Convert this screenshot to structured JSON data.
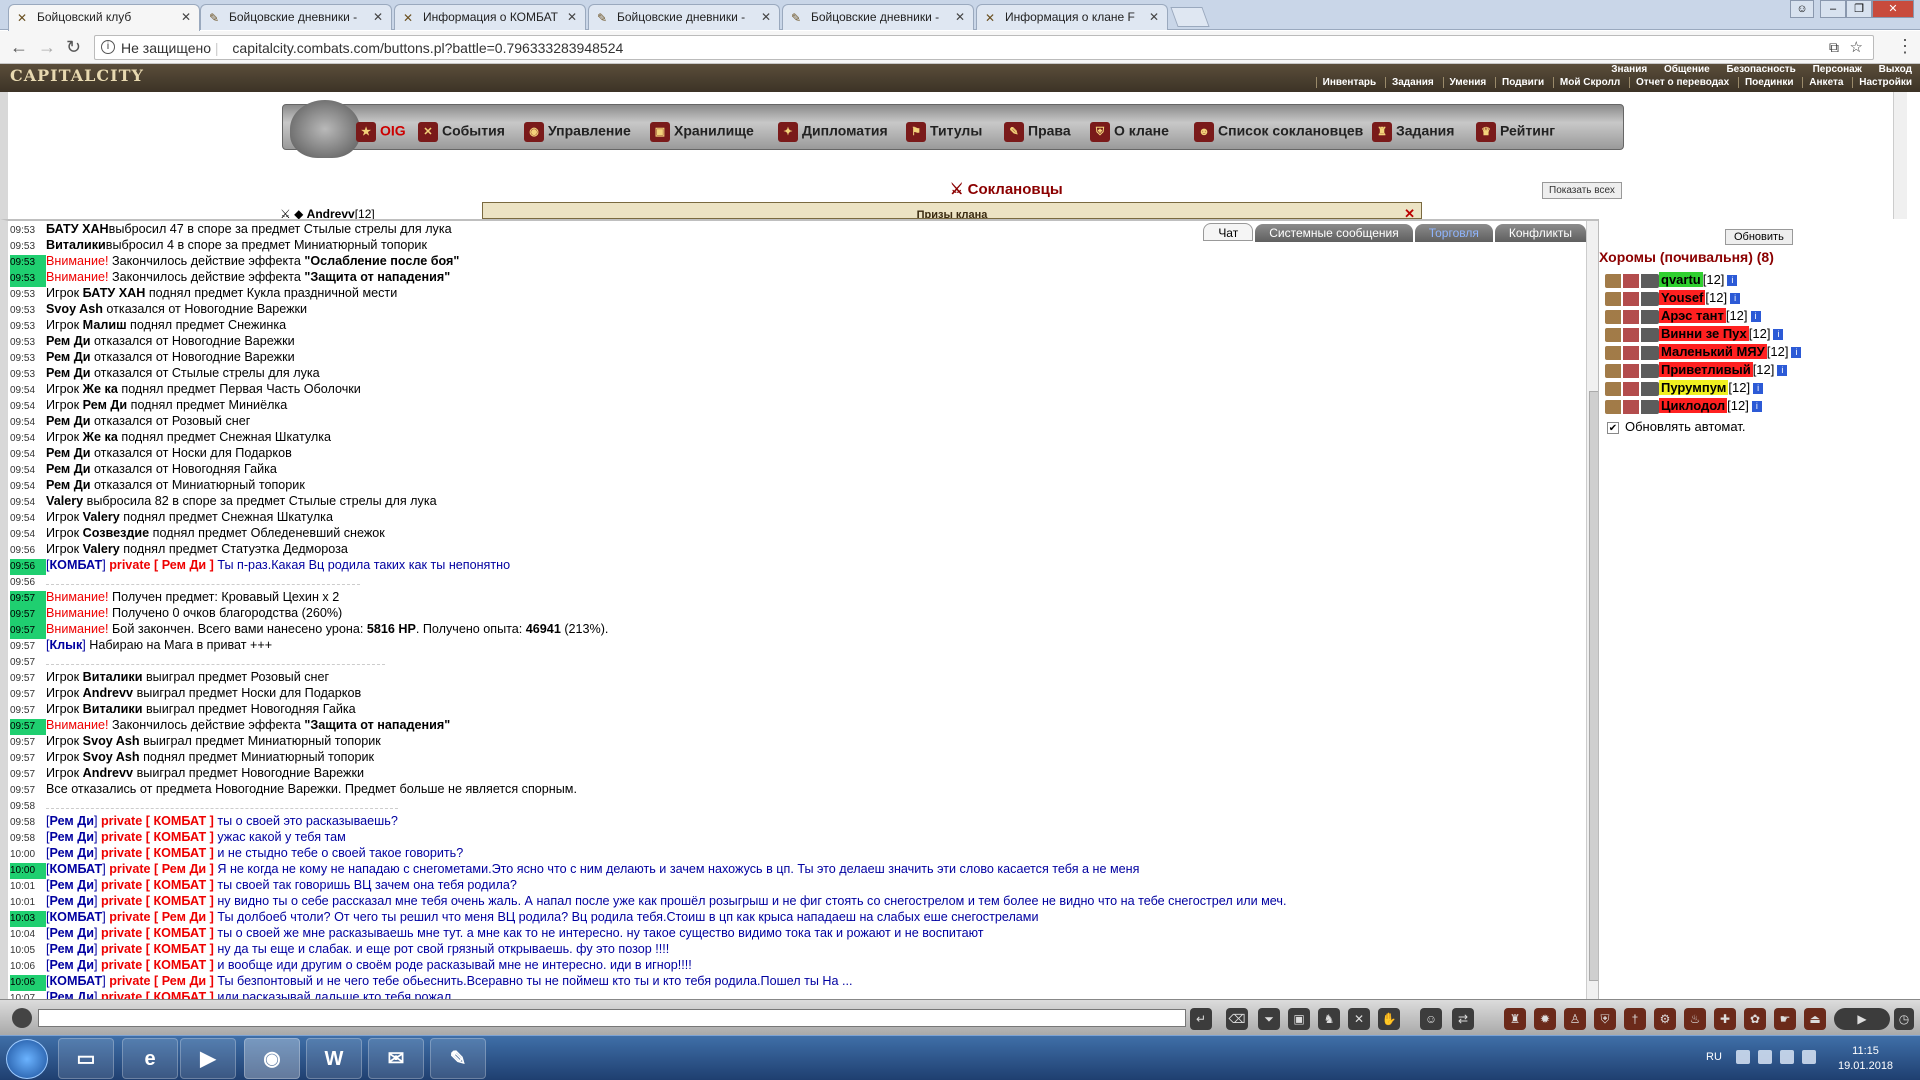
{
  "browser": {
    "tabs": [
      {
        "label": "Бойцовский клуб",
        "active": true
      },
      {
        "label": "Бойцовские дневники -",
        "active": false
      },
      {
        "label": "Информация о КОМБАТ",
        "active": false
      },
      {
        "label": "Бойцовские дневники -",
        "active": false
      },
      {
        "label": "Бойцовские дневники -",
        "active": false
      },
      {
        "label": "Информация о клане F",
        "active": false
      }
    ],
    "security_label": "Не защищено",
    "url": "capitalcity.combats.com/buttons.pl?battle=0.796333283948524"
  },
  "game_header": {
    "logo": "CAPITALCITY",
    "top_links": [
      "Знания",
      "Общение",
      "Безопасность",
      "Персонаж",
      "Выход"
    ],
    "sub_links": [
      "Инвентарь",
      "Задания",
      "Умения",
      "Подвиги",
      "Мой Скролл",
      "Отчет о переводах",
      "Поединки",
      "Анкета",
      "Настройки"
    ]
  },
  "clan_menu": {
    "items": [
      "OIG",
      "События",
      "Управление",
      "Хранилище",
      "Дипломатия",
      "Титулы",
      "Права",
      "О клане",
      "Список соклановцев",
      "Задания",
      "Рейтинг"
    ],
    "section_title": "Соклановцы",
    "show_all": "Показать всех",
    "partial_member": "Andrevv",
    "partial_level": "[12]",
    "prize_bar": "Призы клана"
  },
  "chat_tabs": [
    {
      "label": "Чат",
      "active": true
    },
    {
      "label": "Системные сообщения",
      "active": false
    },
    {
      "label": "Торговля",
      "active": false
    },
    {
      "label": "Конфликты",
      "active": false
    }
  ],
  "chat_lines": [
    {
      "time": "09:53",
      "g": false,
      "parts": [
        [
          "b",
          "БАТУ ХАН"
        ],
        [
          "",
          "выбросил 47 в споре за предмет Стылые стрелы для лука"
        ]
      ]
    },
    {
      "time": "09:53",
      "g": false,
      "parts": [
        [
          "b",
          "Виталики"
        ],
        [
          "",
          "выбросил 4 в споре за предмет Миниатюрный топорик"
        ]
      ]
    },
    {
      "time": "09:53",
      "g": true,
      "parts": [
        [
          "red",
          "Внимание!"
        ],
        [
          "",
          " Закончилось действие эффекта "
        ],
        [
          "b",
          "\"Ослабление после боя\""
        ]
      ]
    },
    {
      "time": "09:53",
      "g": true,
      "parts": [
        [
          "red",
          "Внимание!"
        ],
        [
          "",
          " Закончилось действие эффекта "
        ],
        [
          "b",
          "\"Защита от нападения\""
        ]
      ]
    },
    {
      "time": "09:53",
      "g": false,
      "parts": [
        [
          "",
          "Игрок "
        ],
        [
          "b",
          "БАТУ ХАН"
        ],
        [
          "",
          " поднял предмет Кукла праздничной мести"
        ]
      ]
    },
    {
      "time": "09:53",
      "g": false,
      "parts": [
        [
          "b",
          "Svoy Ash"
        ],
        [
          "",
          " отказался от Новогодние Варежки"
        ]
      ]
    },
    {
      "time": "09:53",
      "g": false,
      "parts": [
        [
          "",
          "Игрок "
        ],
        [
          "b",
          "Малиш"
        ],
        [
          "",
          " поднял предмет Снежинка"
        ]
      ]
    },
    {
      "time": "09:53",
      "g": false,
      "parts": [
        [
          "b",
          "Рем Ди"
        ],
        [
          "",
          " отказался от Новогодние Варежки"
        ]
      ]
    },
    {
      "time": "09:53",
      "g": false,
      "parts": [
        [
          "b",
          "Рем Ди"
        ],
        [
          "",
          " отказался от Новогодние Варежки"
        ]
      ]
    },
    {
      "time": "09:53",
      "g": false,
      "parts": [
        [
          "b",
          "Рем Ди"
        ],
        [
          "",
          " отказался от Стылые стрелы для лука"
        ]
      ]
    },
    {
      "time": "09:54",
      "g": false,
      "parts": [
        [
          "",
          "Игрок "
        ],
        [
          "b",
          "Же ка"
        ],
        [
          "",
          " поднял предмет Первая Часть Оболочки"
        ]
      ]
    },
    {
      "time": "09:54",
      "g": false,
      "parts": [
        [
          "",
          "Игрок "
        ],
        [
          "b",
          "Рем Ди"
        ],
        [
          "",
          " поднял предмет Миниёлка"
        ]
      ]
    },
    {
      "time": "09:54",
      "g": false,
      "parts": [
        [
          "b",
          "Рем Ди"
        ],
        [
          "",
          " отказался от Розовый снег"
        ]
      ]
    },
    {
      "time": "09:54",
      "g": false,
      "parts": [
        [
          "",
          "Игрок "
        ],
        [
          "b",
          "Же ка"
        ],
        [
          "",
          " поднял предмет Снежная Шкатулка"
        ]
      ]
    },
    {
      "time": "09:54",
      "g": false,
      "parts": [
        [
          "b",
          "Рем Ди"
        ],
        [
          "",
          " отказался от Носки для Подарков"
        ]
      ]
    },
    {
      "time": "09:54",
      "g": false,
      "parts": [
        [
          "b",
          "Рем Ди"
        ],
        [
          "",
          " отказался от Новогодняя Гайка"
        ]
      ]
    },
    {
      "time": "09:54",
      "g": false,
      "parts": [
        [
          "b",
          "Рем Ди"
        ],
        [
          "",
          " отказался от Миниатюрный топорик"
        ]
      ]
    },
    {
      "time": "09:54",
      "g": false,
      "parts": [
        [
          "b",
          "Valery"
        ],
        [
          "",
          " выбросила 82 в споре за предмет Стылые стрелы для лука"
        ]
      ]
    },
    {
      "time": "09:54",
      "g": false,
      "parts": [
        [
          "",
          "Игрок "
        ],
        [
          "b",
          "Valery"
        ],
        [
          "",
          " поднял предмет Снежная Шкатулка"
        ]
      ]
    },
    {
      "time": "09:54",
      "g": false,
      "parts": [
        [
          "",
          "Игрок "
        ],
        [
          "b",
          "Созвездие"
        ],
        [
          "",
          " поднял предмет Обледеневший снежок"
        ]
      ]
    },
    {
      "time": "09:56",
      "g": false,
      "parts": [
        [
          "",
          "Игрок "
        ],
        [
          "b",
          "Valery"
        ],
        [
          "",
          " поднял предмет Статуэтка Дедмороза"
        ]
      ]
    },
    {
      "time": "09:56",
      "g": true,
      "parts": [
        [
          "blue",
          "["
        ],
        [
          "nm",
          "КОМБАТ"
        ],
        [
          "blue",
          "] "
        ],
        [
          "pr",
          "private [ Рем Ди ]"
        ],
        [
          "blue",
          " Ты п-раз.Какая Вц родила таких как ты непонятно"
        ]
      ]
    },
    {
      "time": "09:56",
      "g": false,
      "parts": [
        [
          "smudge",
          ""
        ]
      ]
    },
    {
      "time": "09:57",
      "g": true,
      "parts": [
        [
          "red",
          "Внимание!"
        ],
        [
          "",
          " Получен предмет: Кровавый Цехин x 2"
        ]
      ]
    },
    {
      "time": "09:57",
      "g": true,
      "parts": [
        [
          "red",
          "Внимание!"
        ],
        [
          "",
          " Получено 0 очков благородства (260%)"
        ]
      ]
    },
    {
      "time": "09:57",
      "g": true,
      "parts": [
        [
          "red",
          "Внимание!"
        ],
        [
          "",
          " Бой закончен. Всего вами нанесено урона: "
        ],
        [
          "b",
          "5816 HP"
        ],
        [
          "",
          ". Получено опыта: "
        ],
        [
          "b",
          "46941"
        ],
        [
          "",
          " (213%)."
        ]
      ]
    },
    {
      "time": "09:57",
      "g": false,
      "parts": [
        [
          "blue",
          "["
        ],
        [
          "nm",
          "Клык"
        ],
        [
          "blue",
          "] "
        ],
        [
          "",
          "Набираю на Мага в приват +++"
        ]
      ]
    },
    {
      "time": "09:57",
      "g": false,
      "parts": [
        [
          "smudge",
          ""
        ]
      ]
    },
    {
      "time": "09:57",
      "g": false,
      "parts": [
        [
          "",
          "Игрок "
        ],
        [
          "b",
          "Виталики"
        ],
        [
          "",
          " выиграл предмет Розовый снег"
        ]
      ]
    },
    {
      "time": "09:57",
      "g": false,
      "parts": [
        [
          "",
          "Игрок "
        ],
        [
          "b",
          "Andrevv"
        ],
        [
          "",
          " выиграл предмет Носки для Подарков"
        ]
      ]
    },
    {
      "time": "09:57",
      "g": false,
      "parts": [
        [
          "",
          "Игрок "
        ],
        [
          "b",
          "Виталики"
        ],
        [
          "",
          " выиграл предмет Новогодняя Гайка"
        ]
      ]
    },
    {
      "time": "09:57",
      "g": true,
      "parts": [
        [
          "red",
          "Внимание!"
        ],
        [
          "",
          " Закончилось действие эффекта "
        ],
        [
          "b",
          "\"Защита от нападения\""
        ]
      ]
    },
    {
      "time": "09:57",
      "g": false,
      "parts": [
        [
          "",
          "Игрок "
        ],
        [
          "b",
          "Svoy Ash"
        ],
        [
          "",
          " выиграл предмет Миниатюрный топорик"
        ]
      ]
    },
    {
      "time": "09:57",
      "g": false,
      "parts": [
        [
          "",
          "Игрок "
        ],
        [
          "b",
          "Svoy Ash"
        ],
        [
          "",
          " поднял предмет Миниатюрный топорик"
        ]
      ]
    },
    {
      "time": "09:57",
      "g": false,
      "parts": [
        [
          "",
          "Игрок "
        ],
        [
          "b",
          "Andrevv"
        ],
        [
          "",
          " выиграл предмет Новогодние Варежки"
        ]
      ]
    },
    {
      "time": "09:57",
      "g": false,
      "parts": [
        [
          "",
          "Все отказались от предмета Новогодние Варежки. Предмет больше не является спорным."
        ]
      ]
    },
    {
      "time": "09:58",
      "g": false,
      "parts": [
        [
          "smudge",
          ""
        ]
      ]
    },
    {
      "time": "09:58",
      "g": false,
      "parts": [
        [
          "blue",
          "["
        ],
        [
          "nm",
          "Рем Ди"
        ],
        [
          "blue",
          "] "
        ],
        [
          "pr",
          "private [ КОМБАТ ]"
        ],
        [
          "blue",
          " ты о своей это расказываешь?"
        ]
      ]
    },
    {
      "time": "09:58",
      "g": false,
      "parts": [
        [
          "blue",
          "["
        ],
        [
          "nm",
          "Рем Ди"
        ],
        [
          "blue",
          "] "
        ],
        [
          "pr",
          "private [ КОМБАТ ]"
        ],
        [
          "blue",
          " ужас какой у тебя там"
        ]
      ]
    },
    {
      "time": "10:00",
      "g": false,
      "parts": [
        [
          "blue",
          "["
        ],
        [
          "nm",
          "Рем Ди"
        ],
        [
          "blue",
          "] "
        ],
        [
          "pr",
          "private [ КОМБАТ ]"
        ],
        [
          "blue",
          " и не стыдно тебе о своей такое говорить?"
        ]
      ]
    },
    {
      "time": "10:00",
      "g": true,
      "parts": [
        [
          "blue",
          "["
        ],
        [
          "nm",
          "КОМБАТ"
        ],
        [
          "blue",
          "] "
        ],
        [
          "pr",
          "private [ Рем Ди ]"
        ],
        [
          "blue",
          " Я не когда не кому не нападаю с снегометами.Это ясно что с ним делають и зачем нахожусь в цп. Ты это делаеш значить эти слово касается тебя а не меня"
        ]
      ]
    },
    {
      "time": "10:01",
      "g": false,
      "parts": [
        [
          "blue",
          "["
        ],
        [
          "nm",
          "Рем Ди"
        ],
        [
          "blue",
          "] "
        ],
        [
          "pr",
          "private [ КОМБАТ ]"
        ],
        [
          "blue",
          " ты своей так говоришь ВЦ зачем она тебя родила?"
        ]
      ]
    },
    {
      "time": "10:01",
      "g": false,
      "parts": [
        [
          "blue",
          "["
        ],
        [
          "nm",
          "Рем Ди"
        ],
        [
          "blue",
          "] "
        ],
        [
          "pr",
          "private [ КОМБАТ ]"
        ],
        [
          "blue",
          " ну видно ты о себе рассказал мне тебя очень жаль. А напал после уже как прошёл розыгрыш и не фиг стоять со снегострелом и тем более не видно что на тебе снегострел или меч."
        ]
      ]
    },
    {
      "time": "10:03",
      "g": true,
      "parts": [
        [
          "blue",
          "["
        ],
        [
          "nm",
          "КОМБАТ"
        ],
        [
          "blue",
          "] "
        ],
        [
          "pr",
          "private [ Рем Ди ]"
        ],
        [
          "blue",
          " Ты долбоеб чтоли? От чего ты решил что меня ВЦ родила? Вц родила тебя.Стоиш в цп как крыса нападаеш на слабых еше снегострелами"
        ]
      ]
    },
    {
      "time": "10:04",
      "g": false,
      "parts": [
        [
          "blue",
          "["
        ],
        [
          "nm",
          "Рем Ди"
        ],
        [
          "blue",
          "] "
        ],
        [
          "pr",
          "private [ КОМБАТ ]"
        ],
        [
          "blue",
          " ты о своей же мне расказываешь мне тут. а мне как то не интересно. ну такое существо видимо тока так и рожают и не воспитают"
        ]
      ]
    },
    {
      "time": "10:05",
      "g": false,
      "parts": [
        [
          "blue",
          "["
        ],
        [
          "nm",
          "Рем Ди"
        ],
        [
          "blue",
          "] "
        ],
        [
          "pr",
          "private [ КОМБАТ ]"
        ],
        [
          "blue",
          " ну да ты еще и слабак. и еще рот свой грязный открываешь. фу это позор !!!!"
        ]
      ]
    },
    {
      "time": "10:06",
      "g": false,
      "parts": [
        [
          "blue",
          "["
        ],
        [
          "nm",
          "Рем Ди"
        ],
        [
          "blue",
          "] "
        ],
        [
          "pr",
          "private [ КОМБАТ ]"
        ],
        [
          "blue",
          " и вообще иди другим о своём роде расказывай мне не интересно. иди в игнор!!!!"
        ]
      ]
    },
    {
      "time": "10:06",
      "g": true,
      "parts": [
        [
          "blue",
          "["
        ],
        [
          "nm",
          "КОМБАТ"
        ],
        [
          "blue",
          "] "
        ],
        [
          "pr",
          "private [ Рем Ди ]"
        ],
        [
          "blue",
          " Ты безпонтовый и не чего тебе обьеснить.Всеравно ты не поймеш кто ты и кто тебя родила.Пошел ты На ..."
        ]
      ]
    },
    {
      "time": "10:07",
      "g": false,
      "parts": [
        [
          "blue",
          "["
        ],
        [
          "nm",
          "Рем Ди"
        ],
        [
          "blue",
          "] "
        ],
        [
          "pr",
          "private [ КОМБАТ ]"
        ],
        [
          "blue",
          " иди расказывай дальше кто тебя рожал"
        ]
      ]
    }
  ],
  "sidebar": {
    "refresh_label": "Обновить",
    "room_title": "Хоромы (почивальня) (8)",
    "members": [
      {
        "nick": "qvartu",
        "level": "[12]",
        "bg": "#2fd02f"
      },
      {
        "nick": "Yousef",
        "level": "[12]",
        "bg": "#ff2020"
      },
      {
        "nick": "Арэс тант",
        "level": "[12]",
        "bg": "#ff2020"
      },
      {
        "nick": "Винни зе Пух",
        "level": "[12]",
        "bg": "#ff2020"
      },
      {
        "nick": "Маленький МЯУ",
        "level": "[12]",
        "bg": "#ff2020"
      },
      {
        "nick": "Приветливый",
        "level": "[12]",
        "bg": "#ff2020"
      },
      {
        "nick": "Пурумпум",
        "level": "[12]",
        "bg": "#f0f020"
      },
      {
        "nick": "Циклодол",
        "level": "[12]",
        "bg": "#ff2020"
      }
    ],
    "auto_refresh_label": "Обновлять автомат."
  },
  "taskbar": {
    "apps": [
      "folder-icon",
      "ie-icon",
      "media-icon",
      "chrome-icon",
      "W",
      "mail-icon",
      "paint-icon"
    ],
    "lang": "RU",
    "time": "11:15",
    "date": "19.01.2018"
  }
}
